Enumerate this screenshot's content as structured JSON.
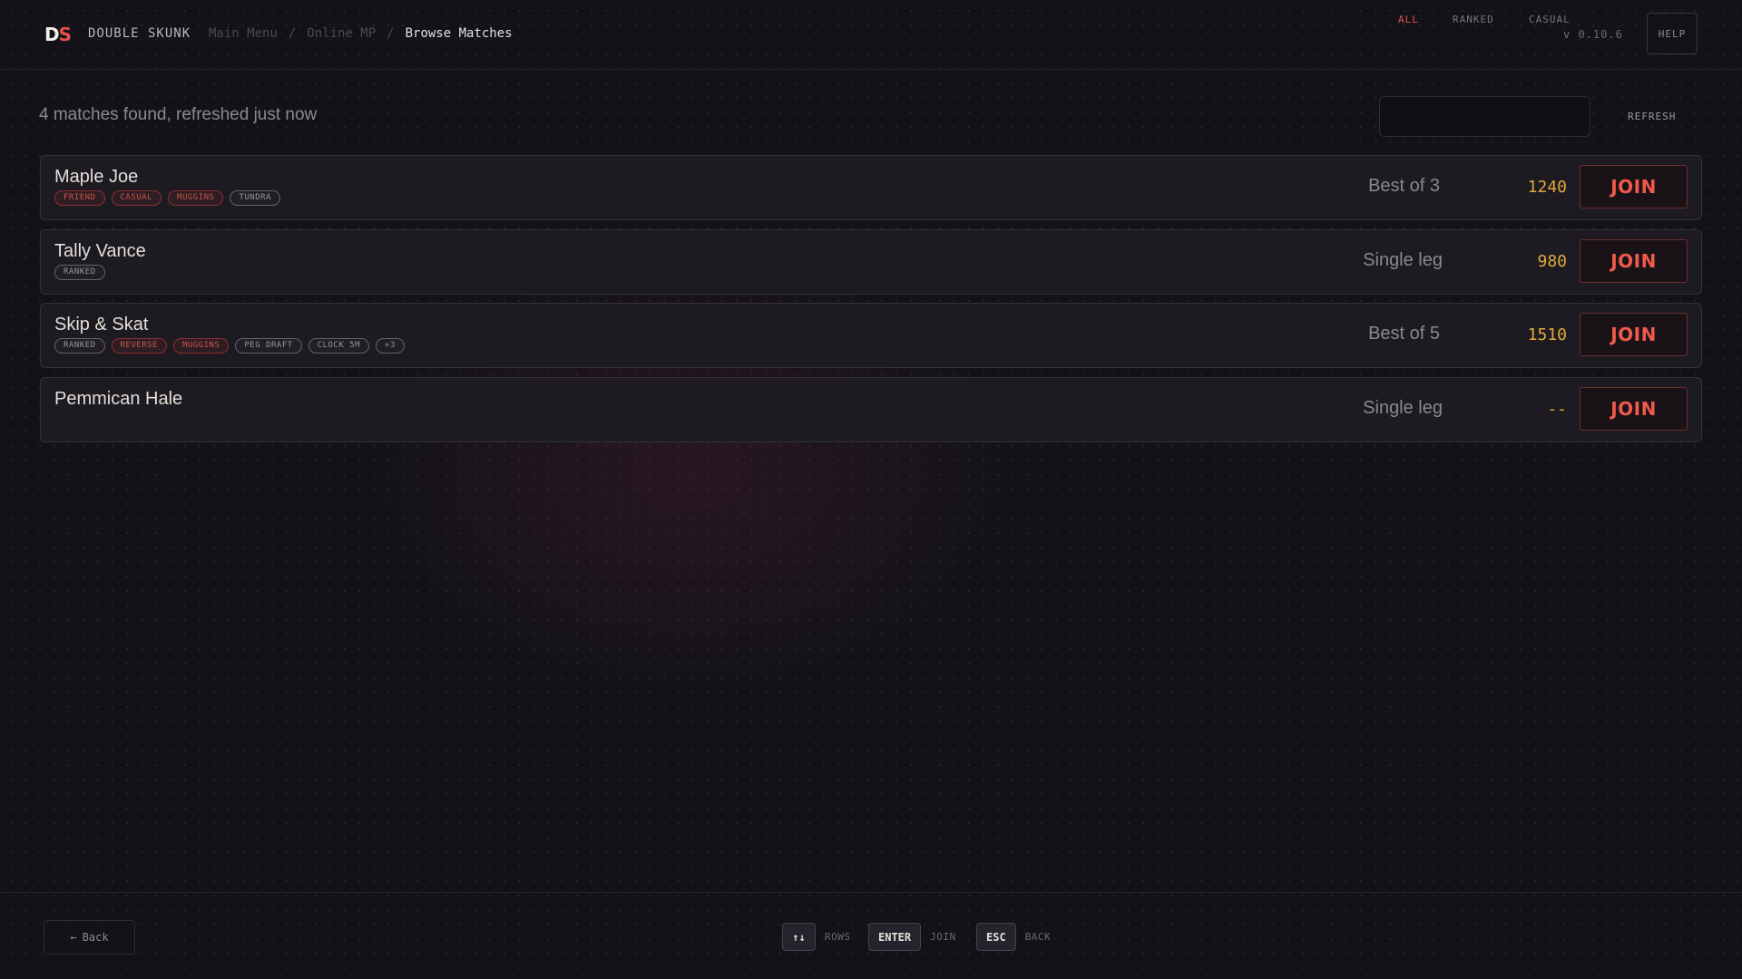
{
  "header": {
    "logo_d": "D",
    "logo_s": "S",
    "brand": "DOUBLE SKUNK",
    "breadcrumbs": [
      "Main Menu",
      "Online MP",
      "Browse Matches"
    ],
    "separator": "/",
    "version": "v 0.10.6",
    "help_label": "HELP"
  },
  "status": "4 matches found, refreshed just now",
  "filters": {
    "items": [
      "ALL",
      "RANKED",
      "CASUAL"
    ],
    "active": "ALL",
    "refresh_label": "REFRESH"
  },
  "matches": [
    {
      "name": "Maple Joe",
      "tags": [
        {
          "label": "FRIEND",
          "style": "red"
        },
        {
          "label": "CASUAL",
          "style": "red"
        },
        {
          "label": "MUGGINS",
          "style": "red"
        },
        {
          "label": "TUNDRA",
          "style": "gray"
        }
      ],
      "format": "Best of 3",
      "rating": "1240",
      "join_label": "JOIN"
    },
    {
      "name": "Tally Vance",
      "tags": [
        {
          "label": "RANKED",
          "style": "gray"
        }
      ],
      "format": "Single leg",
      "rating": "980",
      "join_label": "JOIN"
    },
    {
      "name": "Skip & Skat",
      "tags": [
        {
          "label": "RANKED",
          "style": "gray"
        },
        {
          "label": "REVERSE",
          "style": "red"
        },
        {
          "label": "MUGGINS",
          "style": "red"
        },
        {
          "label": "PEG DRAFT",
          "style": "gray"
        },
        {
          "label": "CLOCK 5M",
          "style": "gray"
        },
        {
          "label": "+3",
          "style": "gray"
        }
      ],
      "format": "Best of 5",
      "rating": "1510",
      "join_label": "JOIN"
    },
    {
      "name": "Pemmican Hale",
      "tags": [],
      "format": "Single leg",
      "rating": "--",
      "join_label": "JOIN"
    }
  ],
  "footer": {
    "back_label": "Back",
    "back_icon": "arrow-left-icon",
    "hints": [
      {
        "key": "↑↓",
        "label": "ROWS"
      },
      {
        "key": "ENTER",
        "label": "JOIN"
      },
      {
        "key": "ESC",
        "label": "BACK"
      }
    ]
  },
  "colors": {
    "accent": "#e8504a",
    "rating": "#e0a93c",
    "background": "#131218"
  }
}
